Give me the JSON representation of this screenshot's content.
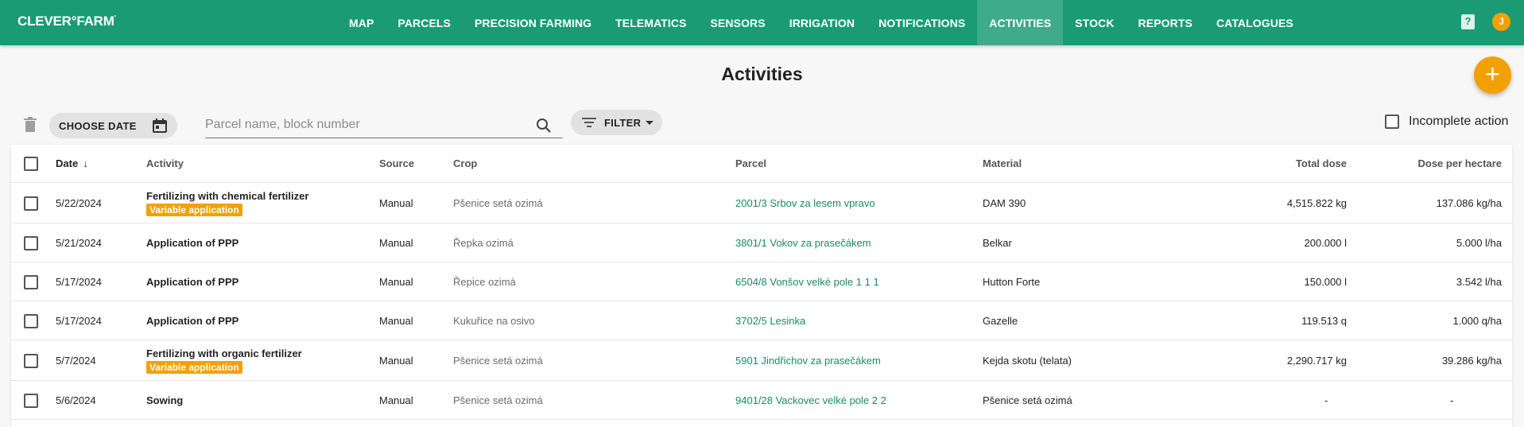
{
  "app": {
    "logo": "CLEVER°FARM",
    "logo_mark": "'",
    "user_initial": "J",
    "help_symbol": "?"
  },
  "nav": {
    "items": [
      {
        "label": "MAP"
      },
      {
        "label": "PARCELS"
      },
      {
        "label": "PRECISION FARMING"
      },
      {
        "label": "TELEMATICS"
      },
      {
        "label": "SENSORS"
      },
      {
        "label": "IRRIGATION"
      },
      {
        "label": "NOTIFICATIONS"
      },
      {
        "label": "ACTIVITIES"
      },
      {
        "label": "STOCK"
      },
      {
        "label": "REPORTS"
      },
      {
        "label": "CATALOGUES"
      }
    ],
    "active": "ACTIVITIES"
  },
  "page": {
    "title": "Activities",
    "fab_symbol": "+"
  },
  "toolbar": {
    "choose_date": "CHOOSE DATE",
    "search_placeholder": "Parcel name, block number",
    "filter_label": "FILTER",
    "incomplete_label": "Incomplete action"
  },
  "table": {
    "headers": {
      "date": "Date",
      "activity": "Activity",
      "source": "Source",
      "crop": "Crop",
      "parcel": "Parcel",
      "material": "Material",
      "total_dose": "Total dose",
      "dose_per_ha": "Dose per hectare"
    },
    "variable_badge": "Variable application",
    "rows": [
      {
        "date": "5/22/2024",
        "activity": "Fertilizing with chemical fertilizer",
        "variable": true,
        "source": "Manual",
        "crop": "Pšenice setá ozimá",
        "parcel": "2001/3 Srbov za lesem vpravo",
        "material": "DAM 390",
        "total_dose": "4,515.822 kg",
        "dose_per_ha": "137.086 kg/ha"
      },
      {
        "date": "5/21/2024",
        "activity": "Application of PPP",
        "variable": false,
        "source": "Manual",
        "crop": "Řepka ozimá",
        "parcel": "3801/1 Vokov za prasečákem",
        "material": "Belkar",
        "total_dose": "200.000 l",
        "dose_per_ha": "5.000 l/ha"
      },
      {
        "date": "5/17/2024",
        "activity": "Application of PPP",
        "variable": false,
        "source": "Manual",
        "crop": "Řepice ozimá",
        "parcel": "6504/8 Vonšov velké pole 1 1 1",
        "material": "Hutton Forte",
        "total_dose": "150.000 l",
        "dose_per_ha": "3.542 l/ha"
      },
      {
        "date": "5/17/2024",
        "activity": "Application of PPP",
        "variable": false,
        "source": "Manual",
        "crop": "Kukuřice na osivo",
        "parcel": "3702/5 Lesinka",
        "material": "Gazelle",
        "total_dose": "119.513 q",
        "dose_per_ha": "1.000 q/ha"
      },
      {
        "date": "5/7/2024",
        "activity": "Fertilizing with organic fertilizer",
        "variable": true,
        "source": "Manual",
        "crop": "Pšenice setá ozimá",
        "parcel": "5901 Jindřichov za prasečákem",
        "material": "Kejda skotu (telata)",
        "total_dose": "2,290.717 kg",
        "dose_per_ha": "39.286 kg/ha"
      },
      {
        "date": "5/6/2024",
        "activity": "Sowing",
        "variable": false,
        "source": "Manual",
        "crop": "Pšenice setá ozimá",
        "parcel": "9401/28 Vackovec velké pole 2 2",
        "material": "Pšenice setá ozimá",
        "total_dose": "-",
        "dose_per_ha": "-"
      }
    ]
  },
  "colors": {
    "brand": "#1a9b74",
    "accent": "#f2a100",
    "link": "#1a8a66"
  }
}
